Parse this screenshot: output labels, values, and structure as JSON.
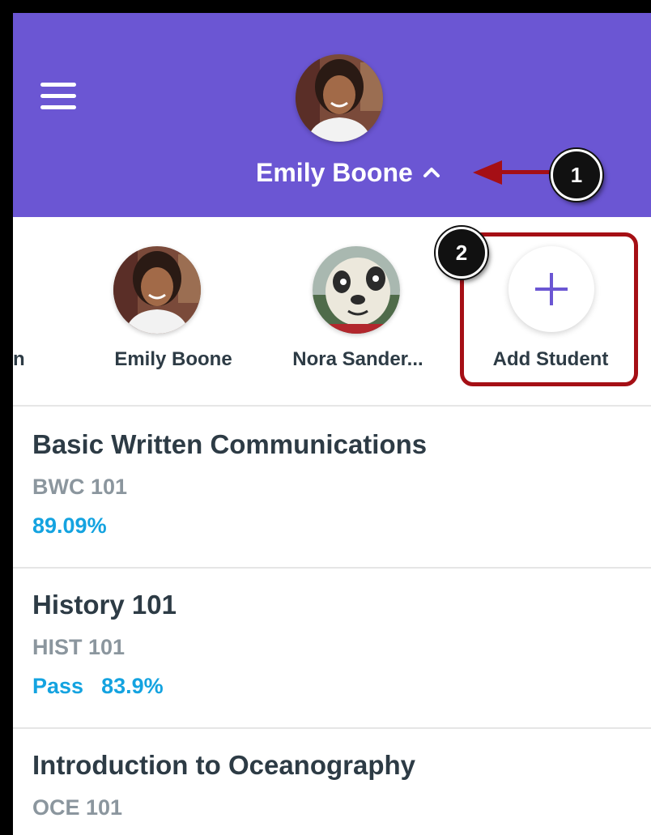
{
  "header": {
    "student_name": "Emily Boone",
    "background": "#6b56d3",
    "menu_icon": "hamburger-menu-icon",
    "expand_icon": "chevron-up-icon"
  },
  "annotations": {
    "callout_1": "1",
    "callout_2": "2",
    "highlight_color": "#a50f15"
  },
  "students": {
    "cut_off_label": "n",
    "items": [
      {
        "name": "Emily Boone"
      },
      {
        "name": "Nora Sander..."
      }
    ],
    "add_label": "Add Student",
    "add_icon": "plus-icon"
  },
  "courses": [
    {
      "title": "Basic Written Communications",
      "code": "BWC 101",
      "grade_primary": "89.09%",
      "grade_secondary": ""
    },
    {
      "title": "History 101",
      "code": "HIST 101",
      "grade_primary": "Pass",
      "grade_secondary": "83.9%"
    },
    {
      "title": "Introduction to Oceanography",
      "code": "OCE 101",
      "grade_primary": "",
      "grade_secondary": ""
    }
  ],
  "colors": {
    "accent": "#6b56d3",
    "grade": "#14a3e0",
    "text": "#2d3b45",
    "muted": "#8b969e"
  }
}
